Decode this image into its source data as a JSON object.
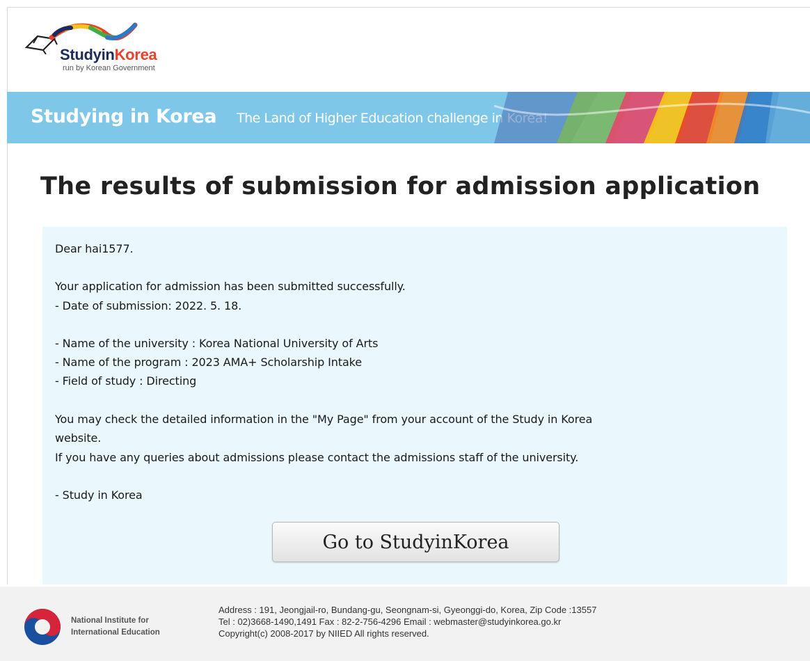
{
  "header": {
    "logo_text": "StudyinKorea",
    "logo_tagline": "run by Korean Government"
  },
  "banner": {
    "title": "Studying in Korea",
    "subtitle": "The Land of Higher Education challenge in Korea!"
  },
  "main": {
    "heading": "The results of submission for admission application",
    "message": {
      "greeting": "Dear hai1577.",
      "submitted_text": "Your application for admission has been submitted successfully.",
      "date_line": "- Date of submission: 2022. 5. 18.",
      "university_line": "- Name of the university : Korea National University of Arts",
      "program_line": "- Name of the program : 2023 AMA+ Scholarship Intake",
      "field_line": "- Field of study : Directing",
      "mypage_line_1": "You may check the detailed information in the \"My Page\" from your account of the Study in Korea",
      "mypage_line_2": "website.",
      "contact_line": "If you have any queries about admissions please contact the admissions staff of the university.",
      "signature": "- Study in Korea"
    },
    "button_label": "Go to StudyinKorea"
  },
  "footer": {
    "org_name_line_1": "National Institute for",
    "org_name_line_2": "International Education",
    "address": "Address : 191, Jeongjail-ro, Bundang-gu, Seongnam-si, Gyeonggi-do, Korea, Zip Code :13557",
    "contact": "Tel : 02)3668-1490,1491 Fax : 82-2-756-4296 Email : webmaster@studyinkorea.go.kr",
    "copyright": "Copyright(c) 2008-2017 by NIIED All rights reserved."
  },
  "colors": {
    "banner_bg": "#7fc7e8",
    "message_bg": "#eaf7fc",
    "footer_bg": "#f2f2f2",
    "logo_navy": "#1d2b5c"
  },
  "icons": {
    "logo": "graduation-cap-ribbon-logo",
    "footer_emblem": "taegeuk-emblem"
  }
}
